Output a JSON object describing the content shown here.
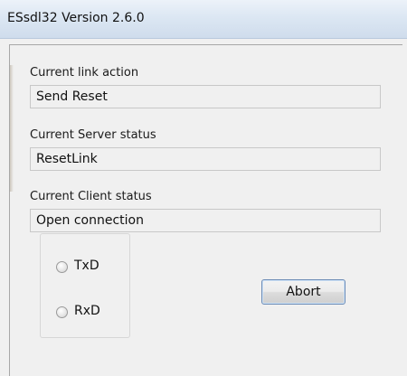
{
  "window": {
    "title": "ESsdl32 Version  2.6.0"
  },
  "link_action": {
    "label": "Current link action",
    "value": "Send Reset"
  },
  "server_status": {
    "label": "Current Server status",
    "value": "ResetLink"
  },
  "client_status": {
    "label": "Current Client status",
    "value": "Open connection"
  },
  "indicators": {
    "txd_label": "TxD",
    "rxd_label": "RxD"
  },
  "actions": {
    "abort_label": "Abort"
  },
  "colors": {
    "titlebar": "#dce7f3",
    "window_bg": "#f0f0f0",
    "button_border": "#6d8cb6"
  }
}
